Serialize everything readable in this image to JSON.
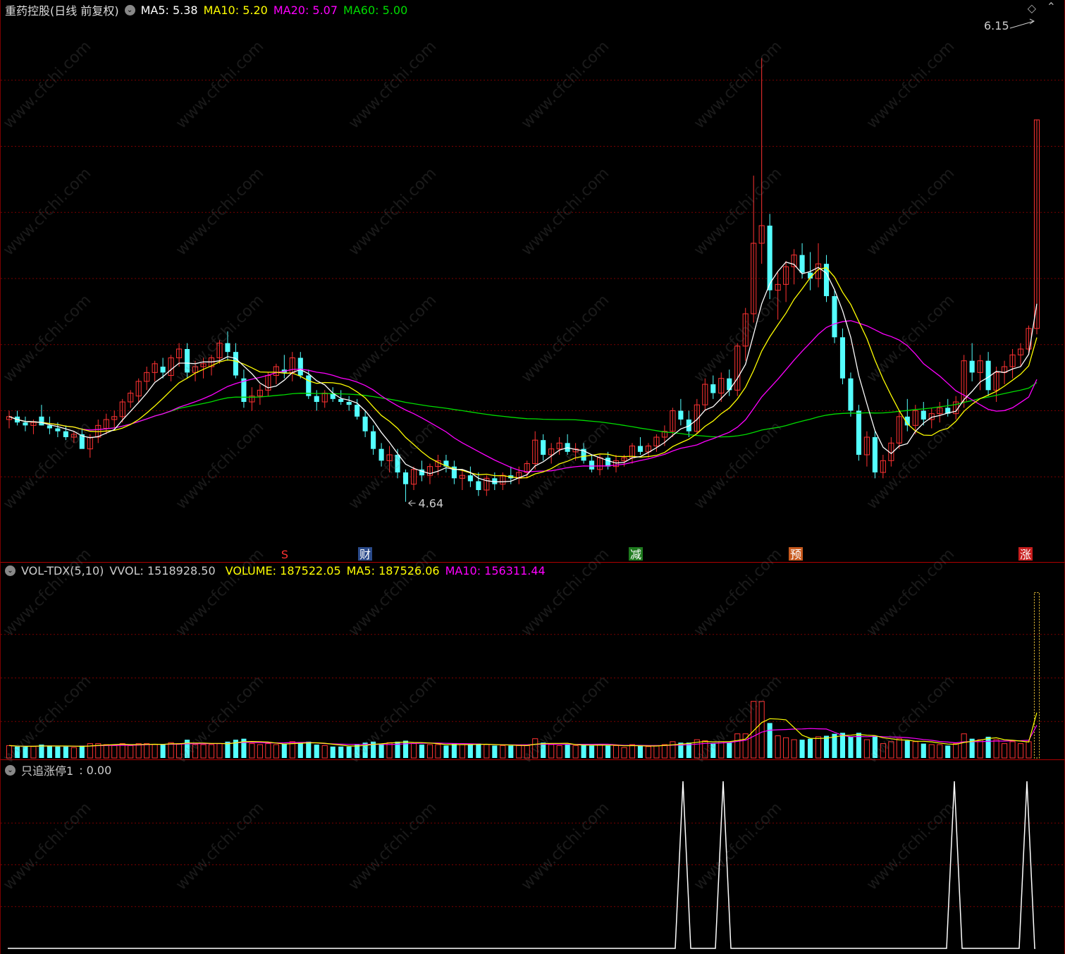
{
  "header": {
    "title": "重药控股(日线 前复权)",
    "ma5": "MA5: 5.38",
    "ma10": "MA10: 5.20",
    "ma20": "MA20: 5.07",
    "ma60": "MA60: 5.00"
  },
  "main_labels": {
    "high_label": "6.15",
    "low_label": "4.64",
    "markers": [
      "S",
      "财",
      "减",
      "预",
      "涨"
    ]
  },
  "vol_header": {
    "name": "VOL-TDX(5,10)",
    "vvol": "VVOL: 1518928.50",
    "volume": "VOLUME: 187522.05",
    "ma5": "MA5: 187526.06",
    "ma10": "MA10: 156311.44"
  },
  "ind_header": {
    "name": "只追涨停1",
    "value": ": 0.00"
  },
  "watermark": "www.cfchi.com",
  "colors": {
    "up": "#ff3232",
    "down": "#54ffff",
    "ma5": "#ffffff",
    "ma10": "#ffff00",
    "ma20": "#ff00ff",
    "ma60": "#00dd00",
    "grid": "#7a0000"
  },
  "chart_data": [
    {
      "type": "candlestick",
      "title": "重药控股(日线 前复权)",
      "ylim": [
        4.5,
        6.3
      ],
      "series": [
        {
          "name": "MA5",
          "last": 5.38
        },
        {
          "name": "MA10",
          "last": 5.2
        },
        {
          "name": "MA20",
          "last": 5.07
        },
        {
          "name": "MA60",
          "last": 5.0
        }
      ],
      "ohlc": [
        [
          4.92,
          4.95,
          4.89,
          4.93
        ],
        [
          4.93,
          4.95,
          4.9,
          4.91
        ],
        [
          4.91,
          4.93,
          4.88,
          4.9
        ],
        [
          4.9,
          4.92,
          4.87,
          4.91
        ],
        [
          4.93,
          4.97,
          4.9,
          4.9
        ],
        [
          4.9,
          4.93,
          4.87,
          4.89
        ],
        [
          4.89,
          4.91,
          4.86,
          4.88
        ],
        [
          4.88,
          4.9,
          4.85,
          4.86
        ],
        [
          4.86,
          4.88,
          4.84,
          4.87
        ],
        [
          4.87,
          4.89,
          4.83,
          4.82
        ],
        [
          4.82,
          4.87,
          4.79,
          4.86
        ],
        [
          4.86,
          4.92,
          4.84,
          4.9
        ],
        [
          4.89,
          4.94,
          4.87,
          4.92
        ],
        [
          4.92,
          4.95,
          4.89,
          4.93
        ],
        [
          4.93,
          4.99,
          4.91,
          4.98
        ],
        [
          4.98,
          5.02,
          4.96,
          5.01
        ],
        [
          5.0,
          5.06,
          4.98,
          5.05
        ],
        [
          5.05,
          5.1,
          5.02,
          5.08
        ],
        [
          5.08,
          5.12,
          5.05,
          5.11
        ],
        [
          5.1,
          5.13,
          5.06,
          5.08
        ],
        [
          5.07,
          5.14,
          5.05,
          5.13
        ],
        [
          5.13,
          5.18,
          5.1,
          5.16
        ],
        [
          5.16,
          5.18,
          5.06,
          5.08
        ],
        [
          5.08,
          5.12,
          5.05,
          5.1
        ],
        [
          5.1,
          5.13,
          5.06,
          5.11
        ],
        [
          5.1,
          5.14,
          5.07,
          5.13
        ],
        [
          5.13,
          5.19,
          5.11,
          5.18
        ],
        [
          5.18,
          5.22,
          5.12,
          5.15
        ],
        [
          5.15,
          5.18,
          5.06,
          5.07
        ],
        [
          5.06,
          5.09,
          4.96,
          4.98
        ],
        [
          4.98,
          5.03,
          4.95,
          5.0
        ],
        [
          5.0,
          5.04,
          4.97,
          5.02
        ],
        [
          5.02,
          5.08,
          5.0,
          5.07
        ],
        [
          5.07,
          5.11,
          5.04,
          5.1
        ],
        [
          5.09,
          5.14,
          5.06,
          5.08
        ],
        [
          5.08,
          5.15,
          5.05,
          5.13
        ],
        [
          5.13,
          5.15,
          5.06,
          5.07
        ],
        [
          5.07,
          5.09,
          4.99,
          5.0
        ],
        [
          5.0,
          5.02,
          4.95,
          4.98
        ],
        [
          4.98,
          5.02,
          4.96,
          5.01
        ],
        [
          5.01,
          5.03,
          4.98,
          4.99
        ],
        [
          4.99,
          5.02,
          4.97,
          4.98
        ],
        [
          4.98,
          5.0,
          4.95,
          4.97
        ],
        [
          4.97,
          4.99,
          4.92,
          4.93
        ],
        [
          4.93,
          4.95,
          4.86,
          4.88
        ],
        [
          4.88,
          4.9,
          4.8,
          4.82
        ],
        [
          4.82,
          4.84,
          4.76,
          4.78
        ],
        [
          4.78,
          4.83,
          4.74,
          4.8
        ],
        [
          4.8,
          4.82,
          4.72,
          4.74
        ],
        [
          4.74,
          4.75,
          4.64,
          4.7
        ],
        [
          4.7,
          4.76,
          4.68,
          4.75
        ],
        [
          4.75,
          4.78,
          4.71,
          4.73
        ],
        [
          4.73,
          4.77,
          4.7,
          4.76
        ],
        [
          4.76,
          4.8,
          4.73,
          4.78
        ],
        [
          4.78,
          4.8,
          4.74,
          4.76
        ],
        [
          4.76,
          4.78,
          4.7,
          4.72
        ],
        [
          4.72,
          4.75,
          4.68,
          4.73
        ],
        [
          4.73,
          4.76,
          4.69,
          4.71
        ],
        [
          4.71,
          4.74,
          4.66,
          4.68
        ],
        [
          4.68,
          4.73,
          4.66,
          4.72
        ],
        [
          4.72,
          4.74,
          4.68,
          4.7
        ],
        [
          4.7,
          4.74,
          4.68,
          4.73
        ],
        [
          4.73,
          4.76,
          4.7,
          4.72
        ],
        [
          4.72,
          4.76,
          4.7,
          4.74
        ],
        [
          4.74,
          4.78,
          4.72,
          4.77
        ],
        [
          4.77,
          4.88,
          4.75,
          4.85
        ],
        [
          4.85,
          4.87,
          4.78,
          4.8
        ],
        [
          4.8,
          4.84,
          4.77,
          4.82
        ],
        [
          4.82,
          4.86,
          4.8,
          4.84
        ],
        [
          4.84,
          4.87,
          4.8,
          4.81
        ],
        [
          4.81,
          4.84,
          4.78,
          4.82
        ],
        [
          4.82,
          4.84,
          4.77,
          4.78
        ],
        [
          4.78,
          4.8,
          4.74,
          4.75
        ],
        [
          4.75,
          4.8,
          4.73,
          4.79
        ],
        [
          4.79,
          4.81,
          4.75,
          4.76
        ],
        [
          4.76,
          4.8,
          4.74,
          4.78
        ],
        [
          4.78,
          4.8,
          4.76,
          4.79
        ],
        [
          4.79,
          4.84,
          4.77,
          4.83
        ],
        [
          4.83,
          4.86,
          4.8,
          4.81
        ],
        [
          4.81,
          4.84,
          4.79,
          4.83
        ],
        [
          4.83,
          4.87,
          4.81,
          4.86
        ],
        [
          4.86,
          4.9,
          4.83,
          4.88
        ],
        [
          4.88,
          4.96,
          4.86,
          4.95
        ],
        [
          4.95,
          4.99,
          4.9,
          4.92
        ],
        [
          4.92,
          4.95,
          4.86,
          4.88
        ],
        [
          4.88,
          4.99,
          4.87,
          4.97
        ],
        [
          4.97,
          5.06,
          4.95,
          5.04
        ],
        [
          5.04,
          5.07,
          4.99,
          5.01
        ],
        [
          5.01,
          5.08,
          4.98,
          5.06
        ],
        [
          5.06,
          5.09,
          5.0,
          5.02
        ],
        [
          5.02,
          5.18,
          5.0,
          5.17
        ],
        [
          5.17,
          5.3,
          5.12,
          5.28
        ],
        [
          5.28,
          5.75,
          5.25,
          5.52
        ],
        [
          5.52,
          6.15,
          5.45,
          5.58
        ],
        [
          5.58,
          5.62,
          5.33,
          5.36
        ],
        [
          5.36,
          5.42,
          5.26,
          5.38
        ],
        [
          5.38,
          5.46,
          5.32,
          5.44
        ],
        [
          5.44,
          5.5,
          5.38,
          5.48
        ],
        [
          5.48,
          5.52,
          5.4,
          5.42
        ],
        [
          5.42,
          5.49,
          5.36,
          5.4
        ],
        [
          5.4,
          5.52,
          5.37,
          5.45
        ],
        [
          5.45,
          5.48,
          5.32,
          5.34
        ],
        [
          5.34,
          5.36,
          5.18,
          5.2
        ],
        [
          5.2,
          5.23,
          5.04,
          5.06
        ],
        [
          5.06,
          5.08,
          4.93,
          4.95
        ],
        [
          4.95,
          4.97,
          4.78,
          4.8
        ],
        [
          4.8,
          4.88,
          4.76,
          4.86
        ],
        [
          4.86,
          4.88,
          4.72,
          4.74
        ],
        [
          4.74,
          4.8,
          4.72,
          4.78
        ],
        [
          4.78,
          4.86,
          4.76,
          4.84
        ],
        [
          4.84,
          4.95,
          4.82,
          4.93
        ],
        [
          4.93,
          4.99,
          4.88,
          4.9
        ],
        [
          4.9,
          4.97,
          4.87,
          4.95
        ],
        [
          4.95,
          4.98,
          4.9,
          4.92
        ],
        [
          4.92,
          4.96,
          4.89,
          4.94
        ],
        [
          4.94,
          4.98,
          4.91,
          4.96
        ],
        [
          4.96,
          4.99,
          4.93,
          4.94
        ],
        [
          4.94,
          5.0,
          4.92,
          4.98
        ],
        [
          4.98,
          5.14,
          4.96,
          5.12
        ],
        [
          5.12,
          5.18,
          5.05,
          5.08
        ],
        [
          5.08,
          5.14,
          5.02,
          5.12
        ],
        [
          5.12,
          5.15,
          5.0,
          5.02
        ],
        [
          5.02,
          5.1,
          4.98,
          5.08
        ],
        [
          5.08,
          5.12,
          5.04,
          5.1
        ],
        [
          5.1,
          5.16,
          5.06,
          5.14
        ],
        [
          5.14,
          5.18,
          5.1,
          5.16
        ],
        [
          5.16,
          5.24,
          5.14,
          5.23
        ],
        [
          5.23,
          5.94,
          5.21,
          5.94
        ]
      ]
    },
    {
      "type": "bar",
      "title": "VOL-TDX(5,10)",
      "series": [
        {
          "name": "VOLUME",
          "last": 187522.05
        },
        {
          "name": "MA5",
          "last": 187526.06
        },
        {
          "name": "MA10",
          "last": 156311.44
        }
      ],
      "ylim": [
        0,
        1600000
      ]
    },
    {
      "type": "line",
      "title": "只追涨停1",
      "value": 0.0,
      "spikes_at_index": [
        94,
        99,
        120,
        128
      ]
    }
  ]
}
